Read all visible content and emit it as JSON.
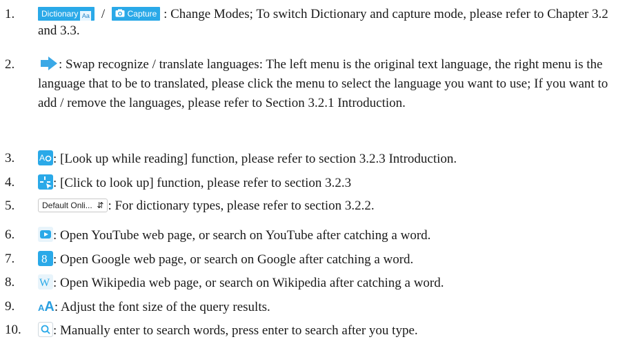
{
  "items": [
    {
      "num": "1.",
      "dict_label": "Dictionary",
      "capture_label": "Capture",
      "text": ": Change Modes; To switch Dictionary and capture mode, please refer to Chapter 3.2 and 3.3."
    },
    {
      "num": "2.",
      "icon": "swap-arrow-icon",
      "text": ": Swap recognize / translate languages: The left menu is the original text language, the right menu is the language that to be to translated, please click the menu to select the language you want to use; If you want to add / remove the languages, please refer to Section 3.2.1 Introduction."
    },
    {
      "num": "3.",
      "icon": "look-up-while-reading-icon",
      "text": ": [Look up while reading] function, please refer to section 3.2.3 Introduction."
    },
    {
      "num": "4.",
      "icon": "click-to-look-up-icon",
      "text": ": [Click to look up] function, please refer to section 3.2.3"
    },
    {
      "num": "5.",
      "select_value": "Default Onli...",
      "text": ": For dictionary types, please refer to section 3.2.2."
    },
    {
      "num": "6.",
      "icon": "youtube-icon",
      "text": ": Open YouTube web page, or search on YouTube after catching a word."
    },
    {
      "num": "7.",
      "icon": "google-icon",
      "text": ": Open Google web page, or search on Google after catching a word."
    },
    {
      "num": "8.",
      "icon": "wikipedia-icon",
      "wiki_glyph": "W",
      "text": ": Open Wikipedia web page, or search on Wikipedia after catching a word."
    },
    {
      "num": "9.",
      "font_small": "A",
      "font_large": "A",
      "text": ": Adjust the font size of the query results."
    },
    {
      "num": "10.",
      "icon": "search-icon",
      "text": ": Manually enter to search words, press enter to search after you type."
    }
  ],
  "colors": {
    "accent": "#2aa9e8",
    "text": "#1a1a1a"
  }
}
